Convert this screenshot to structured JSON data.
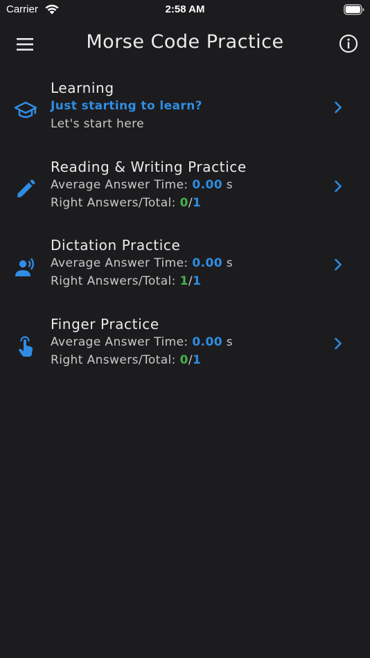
{
  "status_bar": {
    "carrier": "Carrier",
    "time": "2:58 AM"
  },
  "nav": {
    "title": "Morse Code Practice",
    "menu_icon": "hamburger-menu-icon",
    "info_icon": "info-circle-icon"
  },
  "colors": {
    "background": "#1c1c1e",
    "accent": "#2f8de4",
    "success": "#45b34a",
    "text": "#ececec"
  },
  "rows": [
    {
      "icon": "graduation-cap-icon",
      "title": "Learning",
      "subtitle": "Just starting to learn?",
      "description": "Let's start here"
    },
    {
      "icon": "pencil-icon",
      "title": "Reading & Writing Practice",
      "avg_label": "Average Answer Time:",
      "avg_value": "0.00",
      "avg_unit": "s",
      "answers_label": "Right Answers/Total:",
      "right": "0",
      "separator": "/",
      "total": "1"
    },
    {
      "icon": "speaking-person-icon",
      "title": "Dictation Practice",
      "avg_label": "Average Answer Time:",
      "avg_value": "0.00",
      "avg_unit": "s",
      "answers_label": "Right Answers/Total:",
      "right": "1",
      "separator": "/",
      "total": "1"
    },
    {
      "icon": "finger-tap-icon",
      "title": "Finger Practice",
      "avg_label": "Average Answer Time:",
      "avg_value": "0.00",
      "avg_unit": "s",
      "answers_label": "Right Answers/Total:",
      "right": "0",
      "separator": "/",
      "total": "1"
    }
  ]
}
